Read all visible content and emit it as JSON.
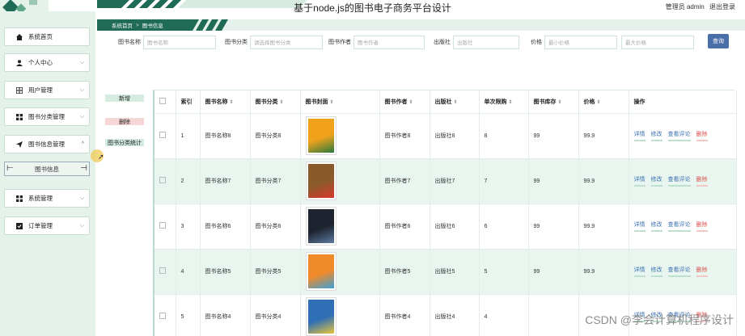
{
  "app": {
    "title": "基于node.js的图书电子商务平台设计"
  },
  "user": {
    "role_name": "管理员 admin",
    "logout": "退出登录"
  },
  "breadcrumb": {
    "home": "系统首页",
    "sep": ">",
    "current": "图书信息"
  },
  "sidebar": {
    "items": [
      {
        "label": "系统首页",
        "icon": "home-icon"
      },
      {
        "label": "个人中心",
        "icon": "user-icon"
      },
      {
        "label": "用户管理",
        "icon": "grid-icon"
      },
      {
        "label": "图书分类管理",
        "icon": "apps-icon"
      },
      {
        "label": "图书信息管理",
        "icon": "send-icon"
      },
      {
        "label": "系统管理",
        "icon": "apps-icon"
      },
      {
        "label": "订单管理",
        "icon": "order-icon"
      }
    ],
    "submenu_label": "图书信息"
  },
  "search": {
    "book_name": {
      "label": "图书名称",
      "placeholder": "图书名称"
    },
    "category": {
      "label": "图书分类",
      "placeholder": "请选择图书分类"
    },
    "author": {
      "label": "图书作者",
      "placeholder": "图书作者"
    },
    "publisher": {
      "label": "出版社",
      "placeholder": "出版社"
    },
    "price": {
      "label": "价格",
      "min_placeholder": "最小价格",
      "max_placeholder": "最大价格"
    },
    "button": "查询"
  },
  "actions": {
    "add": "新增",
    "delete": "删除",
    "stats": "图书分类统计"
  },
  "table": {
    "headers": [
      "索引",
      "图书名称",
      "图书分类",
      "图书封面",
      "图书作者",
      "出版社",
      "单次限购",
      "图书库存",
      "价格",
      "操作"
    ],
    "ops": [
      "详情",
      "修改",
      "查看评论",
      "删除"
    ],
    "rows": [
      {
        "index": "1",
        "name": "图书名称8",
        "category": "图书分类8",
        "author": "图书作者8",
        "publisher": "出版社8",
        "limit": "8",
        "stock": "99",
        "price": "99.9",
        "cover_color": "#f0a21c",
        "cover_accent": "#2b7a3c"
      },
      {
        "index": "2",
        "name": "图书名称7",
        "category": "图书分类7",
        "author": "图书作者7",
        "publisher": "出版社7",
        "limit": "7",
        "stock": "99",
        "price": "99.9",
        "cover_color": "#8b5a2b",
        "cover_accent": "#d9382c"
      },
      {
        "index": "3",
        "name": "图书名称6",
        "category": "图书分类6",
        "author": "图书作者6",
        "publisher": "出版社6",
        "limit": "6",
        "stock": "99",
        "price": "99.9",
        "cover_color": "#1d2430",
        "cover_accent": "#5f7aa0"
      },
      {
        "index": "4",
        "name": "图书名称5",
        "category": "图书分类5",
        "author": "图书作者5",
        "publisher": "出版社5",
        "limit": "5",
        "stock": "99",
        "price": "99.9",
        "cover_color": "#f08a2a",
        "cover_accent": "#3aa0d8"
      },
      {
        "index": "5",
        "name": "图书名称4",
        "category": "图书分类4",
        "author": "图书作者4",
        "publisher": "出版社4",
        "limit": "4",
        "stock": "",
        "price": "",
        "cover_color": "#2f6fb5",
        "cover_accent": "#e8c43a"
      }
    ]
  },
  "watermark": "CSDN @李会计算机程序设计"
}
